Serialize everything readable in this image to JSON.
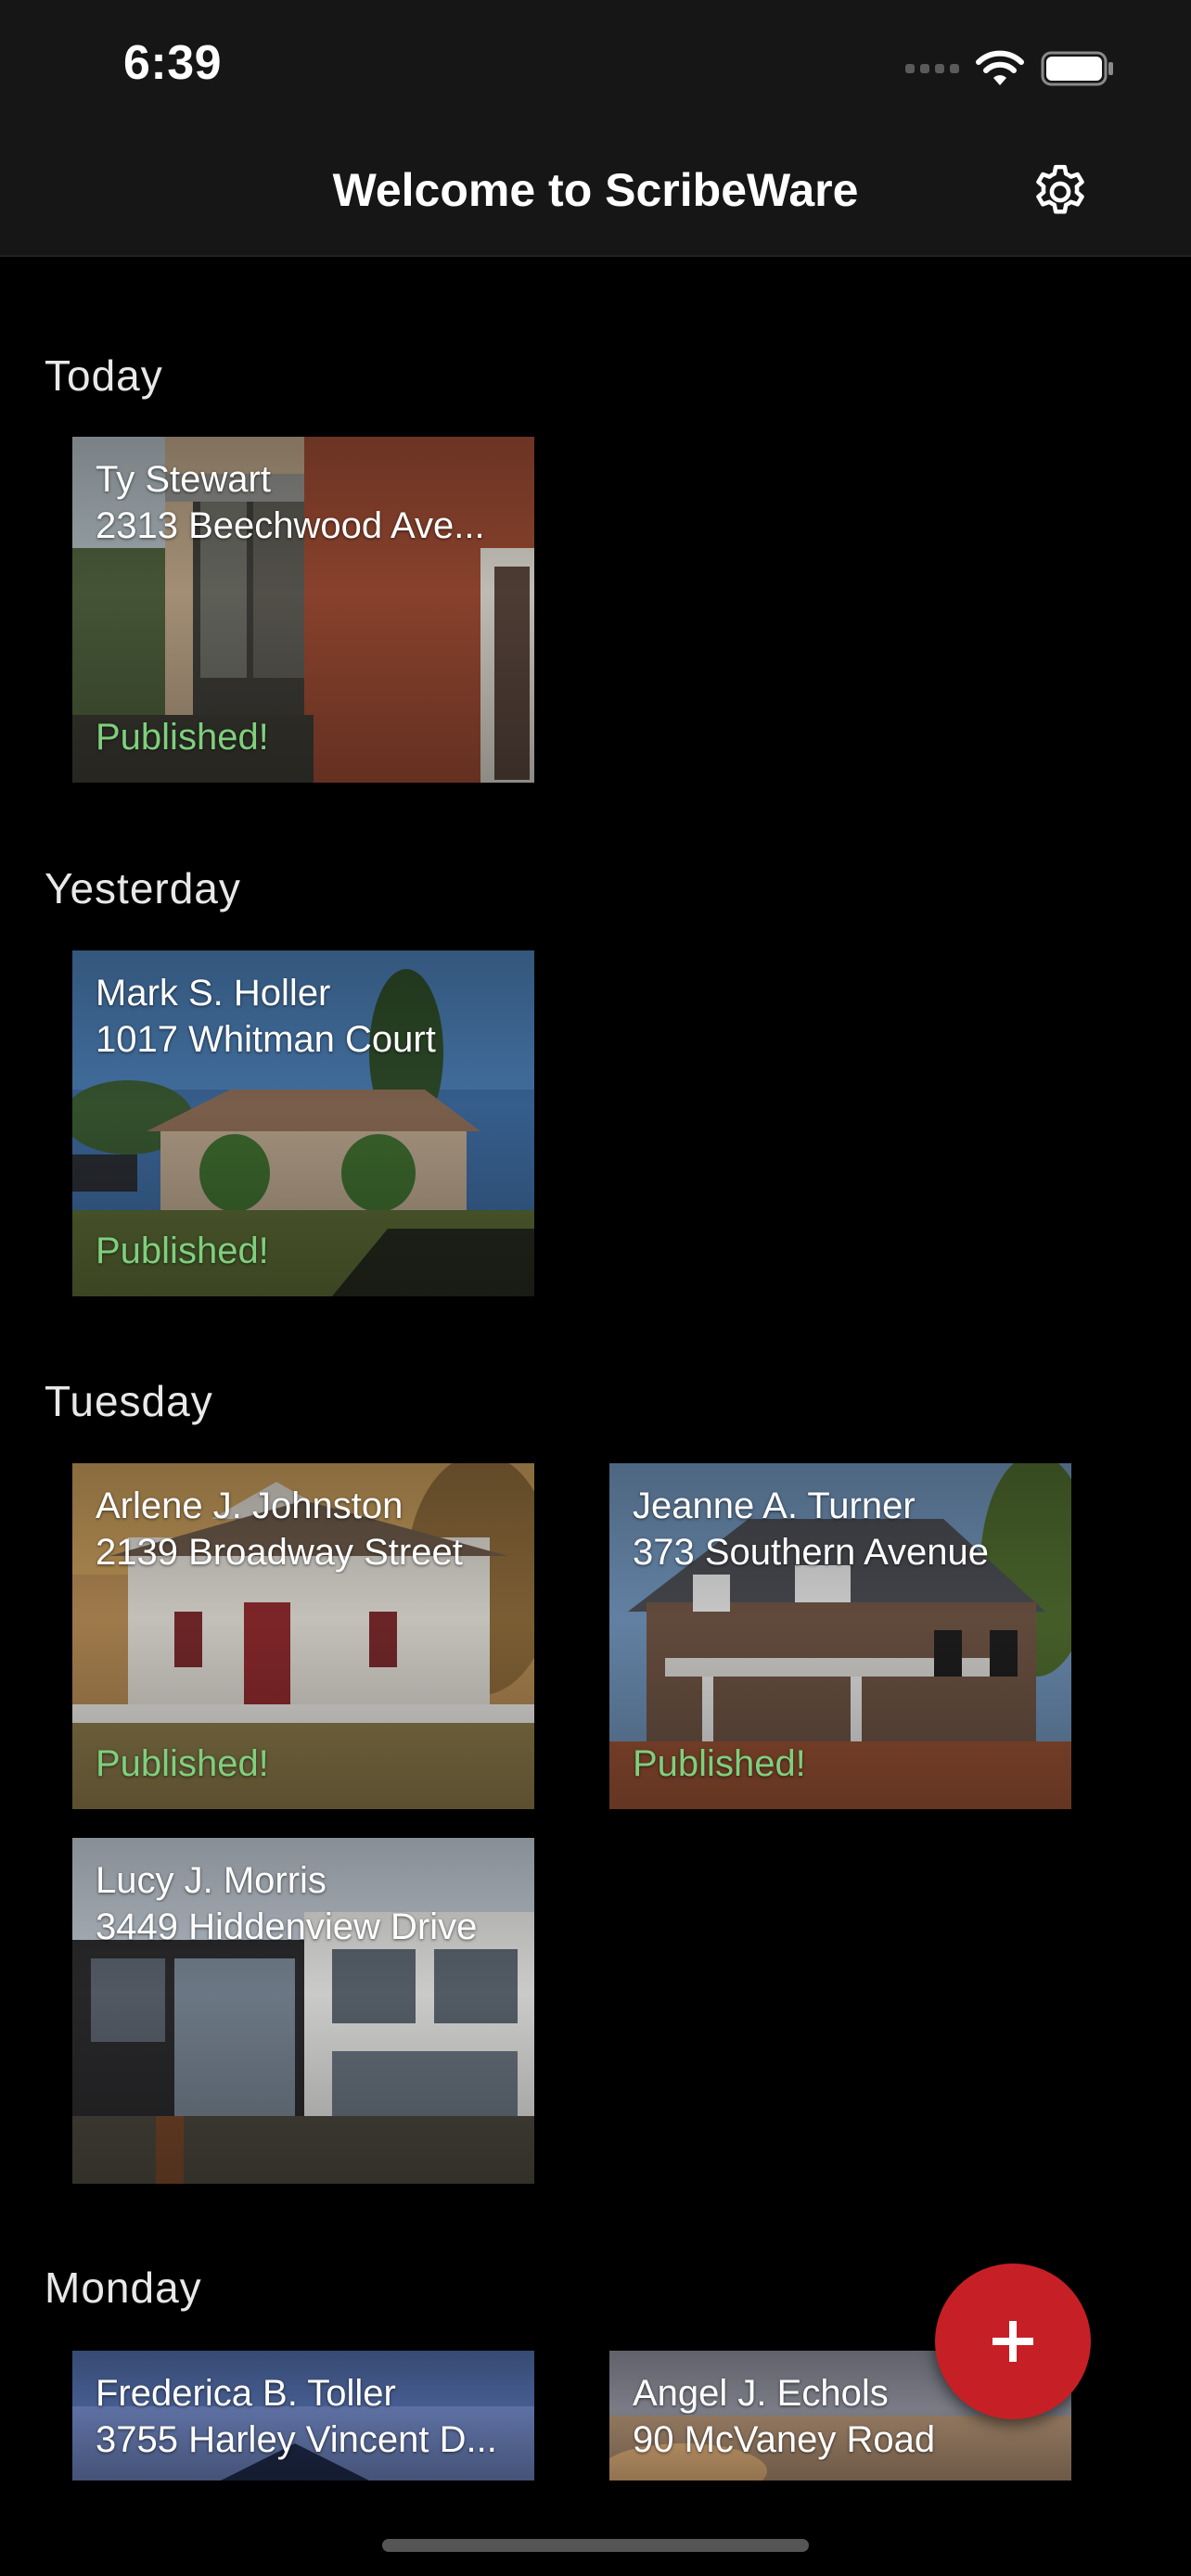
{
  "status_bar": {
    "time": "6:39"
  },
  "header": {
    "title": "Welcome to ScribeWare",
    "settings_icon": "gear-icon"
  },
  "sections": [
    {
      "label": "Today",
      "cards": [
        {
          "name": "Ty Stewart",
          "address": "2313 Beechwood Ave...",
          "status": "Published!"
        }
      ]
    },
    {
      "label": "Yesterday",
      "cards": [
        {
          "name": "Mark S. Holler",
          "address": "1017 Whitman Court",
          "status": "Published!"
        }
      ]
    },
    {
      "label": "Tuesday",
      "cards": [
        {
          "name": "Arlene J. Johnston",
          "address": "2139 Broadway Street",
          "status": "Published!"
        },
        {
          "name": "Jeanne A. Turner",
          "address": "373 Southern Avenue",
          "status": "Published!"
        },
        {
          "name": "Lucy J. Morris",
          "address": "3449 Hiddenview Drive",
          "status": ""
        }
      ]
    },
    {
      "label": "Monday",
      "cards": [
        {
          "name": "Frederica B. Toller",
          "address": "3755 Harley Vincent D...",
          "status": ""
        },
        {
          "name": "Angel J. Echols",
          "address": "90 McVaney Road",
          "status": ""
        }
      ]
    }
  ],
  "fab": {
    "icon": "plus-icon",
    "color": "#c62026"
  },
  "colors": {
    "published": "#7fcf7d",
    "background": "#000000",
    "bar": "#161616"
  }
}
